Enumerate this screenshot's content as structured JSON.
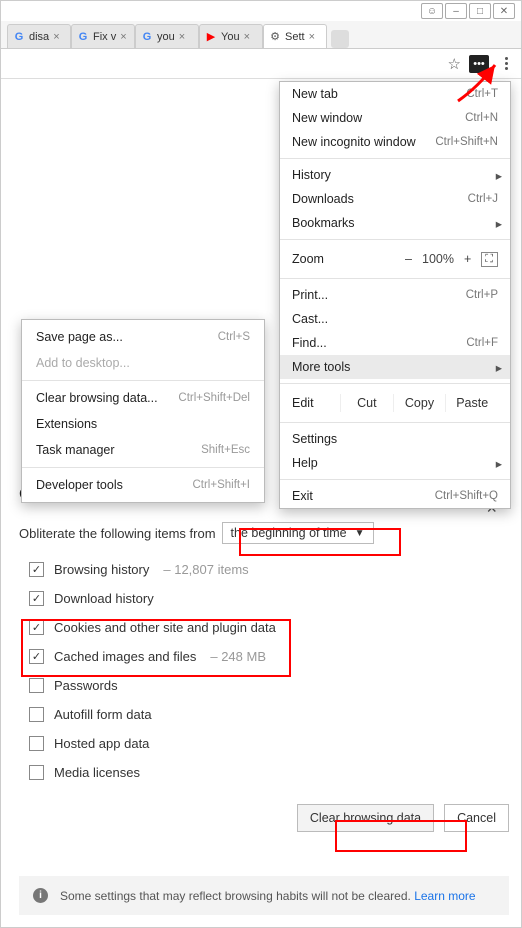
{
  "window": {
    "user_icon": "user",
    "min": "–",
    "max": "□",
    "close": "✕"
  },
  "tabs": [
    {
      "favicon": "G",
      "label": "disa",
      "active": false,
      "favcolor": "#4285F4"
    },
    {
      "favicon": "G",
      "label": "Fix v",
      "active": false,
      "favcolor": "#4285F4"
    },
    {
      "favicon": "G",
      "label": "you",
      "active": false,
      "favcolor": "#4285F4"
    },
    {
      "favicon": "▶",
      "label": "You",
      "active": false,
      "favcolor": "#f00"
    },
    {
      "favicon": "⚙",
      "label": "Sett",
      "active": true,
      "favcolor": "#555"
    }
  ],
  "toolbar": {
    "star": "☆",
    "ext": "•••"
  },
  "menu": {
    "new_tab": {
      "label": "New tab",
      "shortcut": "Ctrl+T"
    },
    "new_window": {
      "label": "New window",
      "shortcut": "Ctrl+N"
    },
    "new_incognito": {
      "label": "New incognito window",
      "shortcut": "Ctrl+Shift+N"
    },
    "history": {
      "label": "History"
    },
    "downloads": {
      "label": "Downloads",
      "shortcut": "Ctrl+J"
    },
    "bookmarks": {
      "label": "Bookmarks"
    },
    "zoom": {
      "label": "Zoom",
      "minus": "–",
      "value": "100%",
      "plus": "+",
      "full": "⛶"
    },
    "print": {
      "label": "Print...",
      "shortcut": "Ctrl+P"
    },
    "cast": {
      "label": "Cast..."
    },
    "find": {
      "label": "Find...",
      "shortcut": "Ctrl+F"
    },
    "more_tools": {
      "label": "More tools"
    },
    "edit": {
      "label": "Edit",
      "cut": "Cut",
      "copy": "Copy",
      "paste": "Paste"
    },
    "settings": {
      "label": "Settings"
    },
    "help": {
      "label": "Help"
    },
    "exit": {
      "label": "Exit",
      "shortcut": "Ctrl+Shift+Q"
    }
  },
  "submenu": {
    "save_page": {
      "label": "Save page as...",
      "shortcut": "Ctrl+S"
    },
    "add_desktop": {
      "label": "Add to desktop..."
    },
    "clear_data": {
      "label": "Clear browsing data...",
      "shortcut": "Ctrl+Shift+Del"
    },
    "extensions": {
      "label": "Extensions"
    },
    "task_manager": {
      "label": "Task manager",
      "shortcut": "Shift+Esc"
    },
    "dev_tools": {
      "label": "Developer tools",
      "shortcut": "Ctrl+Shift+I"
    }
  },
  "dialog": {
    "title": "Clear browsing data",
    "obliterate_label": "Obliterate the following items from",
    "timerange": "the beginning of time",
    "items": {
      "browsing": {
        "label": "Browsing history",
        "detail": "–  12,807 items",
        "checked": true
      },
      "download": {
        "label": "Download history",
        "checked": true
      },
      "cookies": {
        "label": "Cookies and other site and plugin data",
        "checked": true
      },
      "cache": {
        "label": "Cached images and files",
        "detail": "–  248 MB",
        "checked": true
      },
      "passwords": {
        "label": "Passwords",
        "checked": false
      },
      "autofill": {
        "label": "Autofill form data",
        "checked": false
      },
      "hosted": {
        "label": "Hosted app data",
        "checked": false
      },
      "media": {
        "label": "Media licenses",
        "checked": false
      }
    },
    "primary_btn": "Clear browsing data",
    "cancel_btn": "Cancel"
  },
  "footer": {
    "text": "Some settings that may reflect browsing habits will not be cleared.",
    "link": "Learn more"
  }
}
